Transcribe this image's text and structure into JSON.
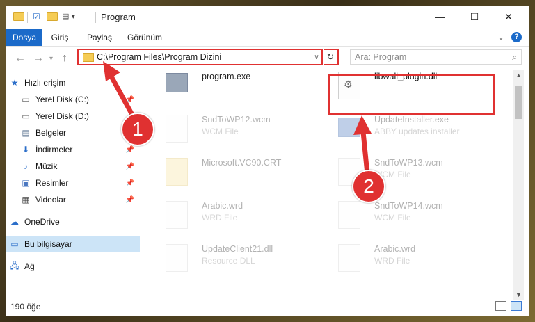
{
  "window": {
    "title": "Program",
    "minimize": "—",
    "maximize": "☐",
    "close": "✕"
  },
  "ribbon": {
    "tabs": [
      "Dosya",
      "Giriş",
      "Paylaş",
      "Görünüm"
    ],
    "help": "?"
  },
  "address": {
    "path": "C:\\Program Files\\Program Dizini",
    "search_placeholder": "Ara: Program"
  },
  "sidebar": {
    "items": [
      {
        "label": "Hızlı erişim",
        "icon": "star-icon"
      },
      {
        "label": "Yerel Disk (C:)",
        "icon": "drive-icon"
      },
      {
        "label": "Yerel Disk (D:)",
        "icon": "drive-icon"
      },
      {
        "label": "Belgeler",
        "icon": "documents-icon"
      },
      {
        "label": "İndirmeler",
        "icon": "download-icon"
      },
      {
        "label": "Müzik",
        "icon": "music-icon"
      },
      {
        "label": "Resimler",
        "icon": "pictures-icon"
      },
      {
        "label": "Videolar",
        "icon": "video-icon"
      },
      {
        "label": "OneDrive",
        "icon": "cloud-icon"
      },
      {
        "label": "Bu bilgisayar",
        "icon": "computer-icon"
      },
      {
        "label": "Ağ",
        "icon": "network-icon"
      }
    ]
  },
  "files": [
    {
      "name": "program.exe",
      "type": ""
    },
    {
      "name": "libwall_plugin.dll",
      "type": ""
    },
    {
      "name": "SndToWP12.wcm",
      "type": "WCM File"
    },
    {
      "name": "UpdateInstaller.exe",
      "type": "ABBY updates installer"
    },
    {
      "name": "Microsoft.VC90.CRT",
      "type": ""
    },
    {
      "name": "SndToWP13.wcm",
      "type": "WCM File"
    },
    {
      "name": "Arabic.wrd",
      "type": "WRD File"
    },
    {
      "name": "SndToWP14.wcm",
      "type": "WCM File"
    },
    {
      "name": "UpdateClient21.dll",
      "type": "Resource DLL"
    },
    {
      "name": "Arabic.wrd",
      "type": "WRD File"
    }
  ],
  "status": {
    "count": "190 öğe"
  },
  "callouts": [
    "1",
    "2"
  ],
  "colors": {
    "accent": "#1b6ac9",
    "highlight": "#e03131",
    "selected_bg": "#cce4f7"
  }
}
